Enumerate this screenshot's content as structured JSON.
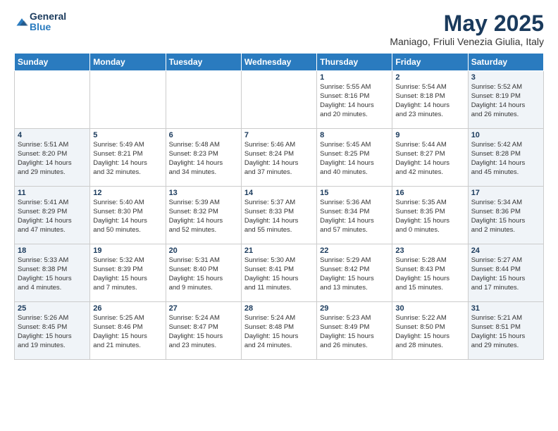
{
  "logo": {
    "general": "General",
    "blue": "Blue"
  },
  "header": {
    "month": "May 2025",
    "location": "Maniago, Friuli Venezia Giulia, Italy"
  },
  "weekdays": [
    "Sunday",
    "Monday",
    "Tuesday",
    "Wednesday",
    "Thursday",
    "Friday",
    "Saturday"
  ],
  "weeks": [
    [
      {
        "day": "",
        "info": ""
      },
      {
        "day": "",
        "info": ""
      },
      {
        "day": "",
        "info": ""
      },
      {
        "day": "",
        "info": ""
      },
      {
        "day": "1",
        "info": "Sunrise: 5:55 AM\nSunset: 8:16 PM\nDaylight: 14 hours\nand 20 minutes."
      },
      {
        "day": "2",
        "info": "Sunrise: 5:54 AM\nSunset: 8:18 PM\nDaylight: 14 hours\nand 23 minutes."
      },
      {
        "day": "3",
        "info": "Sunrise: 5:52 AM\nSunset: 8:19 PM\nDaylight: 14 hours\nand 26 minutes."
      }
    ],
    [
      {
        "day": "4",
        "info": "Sunrise: 5:51 AM\nSunset: 8:20 PM\nDaylight: 14 hours\nand 29 minutes."
      },
      {
        "day": "5",
        "info": "Sunrise: 5:49 AM\nSunset: 8:21 PM\nDaylight: 14 hours\nand 32 minutes."
      },
      {
        "day": "6",
        "info": "Sunrise: 5:48 AM\nSunset: 8:23 PM\nDaylight: 14 hours\nand 34 minutes."
      },
      {
        "day": "7",
        "info": "Sunrise: 5:46 AM\nSunset: 8:24 PM\nDaylight: 14 hours\nand 37 minutes."
      },
      {
        "day": "8",
        "info": "Sunrise: 5:45 AM\nSunset: 8:25 PM\nDaylight: 14 hours\nand 40 minutes."
      },
      {
        "day": "9",
        "info": "Sunrise: 5:44 AM\nSunset: 8:27 PM\nDaylight: 14 hours\nand 42 minutes."
      },
      {
        "day": "10",
        "info": "Sunrise: 5:42 AM\nSunset: 8:28 PM\nDaylight: 14 hours\nand 45 minutes."
      }
    ],
    [
      {
        "day": "11",
        "info": "Sunrise: 5:41 AM\nSunset: 8:29 PM\nDaylight: 14 hours\nand 47 minutes."
      },
      {
        "day": "12",
        "info": "Sunrise: 5:40 AM\nSunset: 8:30 PM\nDaylight: 14 hours\nand 50 minutes."
      },
      {
        "day": "13",
        "info": "Sunrise: 5:39 AM\nSunset: 8:32 PM\nDaylight: 14 hours\nand 52 minutes."
      },
      {
        "day": "14",
        "info": "Sunrise: 5:37 AM\nSunset: 8:33 PM\nDaylight: 14 hours\nand 55 minutes."
      },
      {
        "day": "15",
        "info": "Sunrise: 5:36 AM\nSunset: 8:34 PM\nDaylight: 14 hours\nand 57 minutes."
      },
      {
        "day": "16",
        "info": "Sunrise: 5:35 AM\nSunset: 8:35 PM\nDaylight: 15 hours\nand 0 minutes."
      },
      {
        "day": "17",
        "info": "Sunrise: 5:34 AM\nSunset: 8:36 PM\nDaylight: 15 hours\nand 2 minutes."
      }
    ],
    [
      {
        "day": "18",
        "info": "Sunrise: 5:33 AM\nSunset: 8:38 PM\nDaylight: 15 hours\nand 4 minutes."
      },
      {
        "day": "19",
        "info": "Sunrise: 5:32 AM\nSunset: 8:39 PM\nDaylight: 15 hours\nand 7 minutes."
      },
      {
        "day": "20",
        "info": "Sunrise: 5:31 AM\nSunset: 8:40 PM\nDaylight: 15 hours\nand 9 minutes."
      },
      {
        "day": "21",
        "info": "Sunrise: 5:30 AM\nSunset: 8:41 PM\nDaylight: 15 hours\nand 11 minutes."
      },
      {
        "day": "22",
        "info": "Sunrise: 5:29 AM\nSunset: 8:42 PM\nDaylight: 15 hours\nand 13 minutes."
      },
      {
        "day": "23",
        "info": "Sunrise: 5:28 AM\nSunset: 8:43 PM\nDaylight: 15 hours\nand 15 minutes."
      },
      {
        "day": "24",
        "info": "Sunrise: 5:27 AM\nSunset: 8:44 PM\nDaylight: 15 hours\nand 17 minutes."
      }
    ],
    [
      {
        "day": "25",
        "info": "Sunrise: 5:26 AM\nSunset: 8:45 PM\nDaylight: 15 hours\nand 19 minutes."
      },
      {
        "day": "26",
        "info": "Sunrise: 5:25 AM\nSunset: 8:46 PM\nDaylight: 15 hours\nand 21 minutes."
      },
      {
        "day": "27",
        "info": "Sunrise: 5:24 AM\nSunset: 8:47 PM\nDaylight: 15 hours\nand 23 minutes."
      },
      {
        "day": "28",
        "info": "Sunrise: 5:24 AM\nSunset: 8:48 PM\nDaylight: 15 hours\nand 24 minutes."
      },
      {
        "day": "29",
        "info": "Sunrise: 5:23 AM\nSunset: 8:49 PM\nDaylight: 15 hours\nand 26 minutes."
      },
      {
        "day": "30",
        "info": "Sunrise: 5:22 AM\nSunset: 8:50 PM\nDaylight: 15 hours\nand 28 minutes."
      },
      {
        "day": "31",
        "info": "Sunrise: 5:21 AM\nSunset: 8:51 PM\nDaylight: 15 hours\nand 29 minutes."
      }
    ]
  ]
}
